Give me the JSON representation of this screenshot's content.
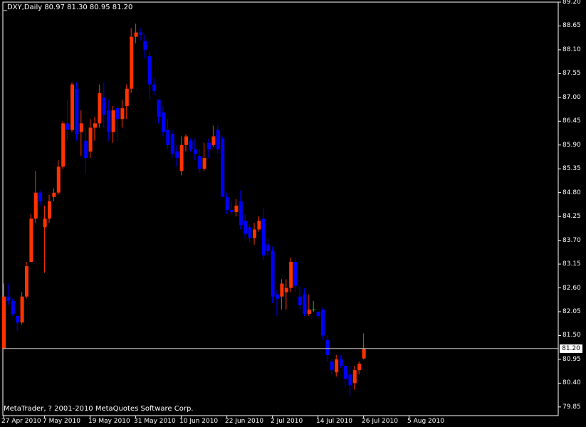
{
  "header": {
    "symbol_info": "_DXY,Daily  80.97 81.30 80.95 81.20"
  },
  "footer": {
    "copyright": "MetaTrader, ? 2001-2010 MetaQuotes Software Corp."
  },
  "colors": {
    "background": "#000000",
    "axis": "#ffffff",
    "bull": "#ff3300",
    "bear": "#0000ff",
    "doji": "#00cc00",
    "price_line": "#c0c0c0"
  },
  "chart_data": {
    "type": "candlestick",
    "symbol": "_DXY",
    "timeframe": "Daily",
    "last_price": "81.20",
    "ylim": [
      79.65,
      89.2
    ],
    "y_ticks": [
      "89.20",
      "88.65",
      "88.10",
      "87.55",
      "87.00",
      "86.45",
      "85.90",
      "85.35",
      "84.80",
      "84.25",
      "83.70",
      "83.15",
      "82.60",
      "82.05",
      "81.50",
      "80.95",
      "80.40",
      "79.85"
    ],
    "x_ticks": [
      "27 Apr 2010",
      "7 May 2010",
      "19 May 2010",
      "31 May 2010",
      "10 Jun 2010",
      "22 Jun 2010",
      "2 Jul 2010",
      "14 Jul 2010",
      "26 Jul 2010",
      "5 Aug 2010"
    ],
    "x_tick_bar_index": [
      0,
      9,
      19,
      29,
      39,
      49,
      59,
      69,
      79,
      89
    ],
    "candles": [
      {
        "o": 81.2,
        "h": 82.7,
        "l": 81.2,
        "c": 82.4
      },
      {
        "o": 82.4,
        "h": 82.7,
        "l": 82.2,
        "c": 82.3
      },
      {
        "o": 82.3,
        "h": 82.35,
        "l": 81.95,
        "c": 82.0
      },
      {
        "o": 81.95,
        "h": 81.95,
        "l": 81.6,
        "c": 81.8
      },
      {
        "o": 81.8,
        "h": 82.5,
        "l": 81.75,
        "c": 82.4
      },
      {
        "o": 82.4,
        "h": 83.2,
        "l": 82.35,
        "c": 83.1
      },
      {
        "o": 83.2,
        "h": 84.3,
        "l": 83.2,
        "c": 84.2
      },
      {
        "o": 84.2,
        "h": 85.3,
        "l": 84.1,
        "c": 84.8
      },
      {
        "o": 84.8,
        "h": 84.85,
        "l": 84.5,
        "c": 84.6
      },
      {
        "o": 84.0,
        "h": 84.5,
        "l": 82.95,
        "c": 84.2
      },
      {
        "o": 84.2,
        "h": 84.75,
        "l": 84.1,
        "c": 84.6
      },
      {
        "o": 84.7,
        "h": 84.9,
        "l": 84.6,
        "c": 84.8
      },
      {
        "o": 84.8,
        "h": 85.55,
        "l": 84.75,
        "c": 85.4
      },
      {
        "o": 85.4,
        "h": 86.45,
        "l": 85.35,
        "c": 86.4
      },
      {
        "o": 86.4,
        "h": 86.95,
        "l": 86.0,
        "c": 86.25
      },
      {
        "o": 86.25,
        "h": 87.35,
        "l": 86.2,
        "c": 87.3
      },
      {
        "o": 87.2,
        "h": 87.35,
        "l": 86.0,
        "c": 86.15
      },
      {
        "o": 86.2,
        "h": 86.7,
        "l": 85.65,
        "c": 86.4
      },
      {
        "o": 86.0,
        "h": 86.3,
        "l": 85.25,
        "c": 85.6
      },
      {
        "o": 85.75,
        "h": 86.5,
        "l": 85.6,
        "c": 86.3
      },
      {
        "o": 86.3,
        "h": 86.55,
        "l": 86.0,
        "c": 86.4
      },
      {
        "o": 86.4,
        "h": 87.3,
        "l": 86.3,
        "c": 87.1
      },
      {
        "o": 87.0,
        "h": 87.35,
        "l": 86.3,
        "c": 86.6
      },
      {
        "o": 86.7,
        "h": 86.95,
        "l": 86.0,
        "c": 86.2
      },
      {
        "o": 86.2,
        "h": 86.8,
        "l": 85.95,
        "c": 86.7
      },
      {
        "o": 86.75,
        "h": 86.8,
        "l": 86.0,
        "c": 86.5
      },
      {
        "o": 86.5,
        "h": 86.95,
        "l": 86.3,
        "c": 86.75
      },
      {
        "o": 86.8,
        "h": 87.3,
        "l": 86.5,
        "c": 87.2
      },
      {
        "o": 87.2,
        "h": 88.6,
        "l": 87.1,
        "c": 88.4
      },
      {
        "o": 88.4,
        "h": 88.7,
        "l": 88.25,
        "c": 88.5
      },
      {
        "o": 88.5,
        "h": 88.6,
        "l": 88.3,
        "c": 88.45
      },
      {
        "o": 88.3,
        "h": 88.45,
        "l": 87.9,
        "c": 88.1
      },
      {
        "o": 87.95,
        "h": 88.05,
        "l": 86.95,
        "c": 87.3
      },
      {
        "o": 87.3,
        "h": 87.45,
        "l": 87.05,
        "c": 87.15
      },
      {
        "o": 86.95,
        "h": 86.95,
        "l": 86.4,
        "c": 86.55
      },
      {
        "o": 86.65,
        "h": 86.8,
        "l": 86.1,
        "c": 86.2
      },
      {
        "o": 86.25,
        "h": 86.5,
        "l": 85.8,
        "c": 85.9
      },
      {
        "o": 86.15,
        "h": 86.25,
        "l": 85.6,
        "c": 85.7
      },
      {
        "o": 85.75,
        "h": 85.9,
        "l": 85.4,
        "c": 85.6
      },
      {
        "o": 85.3,
        "h": 86.1,
        "l": 85.2,
        "c": 85.9
      },
      {
        "o": 85.9,
        "h": 86.15,
        "l": 85.75,
        "c": 86.1
      },
      {
        "o": 86.0,
        "h": 86.05,
        "l": 85.75,
        "c": 85.8
      },
      {
        "o": 85.8,
        "h": 86.05,
        "l": 85.55,
        "c": 85.7
      },
      {
        "o": 85.65,
        "h": 85.8,
        "l": 85.25,
        "c": 85.35
      },
      {
        "o": 85.35,
        "h": 85.95,
        "l": 85.3,
        "c": 85.6
      },
      {
        "o": 85.95,
        "h": 86.05,
        "l": 85.6,
        "c": 85.8
      },
      {
        "o": 85.9,
        "h": 86.35,
        "l": 85.85,
        "c": 86.1
      },
      {
        "o": 86.25,
        "h": 86.35,
        "l": 85.7,
        "c": 85.8
      },
      {
        "o": 86.05,
        "h": 86.1,
        "l": 84.8,
        "c": 84.7
      },
      {
        "o": 84.7,
        "h": 84.8,
        "l": 84.3,
        "c": 84.4
      },
      {
        "o": 84.4,
        "h": 84.6,
        "l": 84.3,
        "c": 84.35
      },
      {
        "o": 84.35,
        "h": 84.65,
        "l": 84.25,
        "c": 84.5
      },
      {
        "o": 84.6,
        "h": 84.85,
        "l": 83.95,
        "c": 84.05
      },
      {
        "o": 84.15,
        "h": 84.3,
        "l": 83.75,
        "c": 83.85
      },
      {
        "o": 84.0,
        "h": 84.05,
        "l": 83.65,
        "c": 83.75
      },
      {
        "o": 83.75,
        "h": 84.1,
        "l": 83.6,
        "c": 83.95
      },
      {
        "o": 83.95,
        "h": 84.25,
        "l": 83.9,
        "c": 84.15
      },
      {
        "o": 84.2,
        "h": 84.45,
        "l": 83.25,
        "c": 83.35
      },
      {
        "o": 83.6,
        "h": 83.75,
        "l": 83.35,
        "c": 83.45
      },
      {
        "o": 83.45,
        "h": 83.55,
        "l": 82.25,
        "c": 82.4
      },
      {
        "o": 82.45,
        "h": 82.55,
        "l": 81.95,
        "c": 82.35
      },
      {
        "o": 82.4,
        "h": 82.8,
        "l": 82.1,
        "c": 82.7
      },
      {
        "o": 82.5,
        "h": 82.8,
        "l": 82.1,
        "c": 82.6
      },
      {
        "o": 82.6,
        "h": 83.3,
        "l": 82.5,
        "c": 83.2
      },
      {
        "o": 83.2,
        "h": 83.3,
        "l": 82.5,
        "c": 82.65
      },
      {
        "o": 82.4,
        "h": 82.65,
        "l": 82.1,
        "c": 82.2
      },
      {
        "o": 82.45,
        "h": 82.6,
        "l": 81.95,
        "c": 82.0
      },
      {
        "o": 82.0,
        "h": 82.45,
        "l": 81.95,
        "c": 82.1
      },
      {
        "o": 82.1,
        "h": 82.3,
        "l": 82.05,
        "c": 82.1
      },
      {
        "o": 82.05,
        "h": 82.05,
        "l": 81.9,
        "c": 81.95
      },
      {
        "o": 82.1,
        "h": 82.15,
        "l": 81.4,
        "c": 81.5
      },
      {
        "o": 81.4,
        "h": 81.5,
        "l": 80.9,
        "c": 81.05
      },
      {
        "o": 80.9,
        "h": 80.95,
        "l": 80.6,
        "c": 80.7
      },
      {
        "o": 80.65,
        "h": 81.05,
        "l": 80.55,
        "c": 80.95
      },
      {
        "o": 80.95,
        "h": 81.05,
        "l": 80.75,
        "c": 80.8
      },
      {
        "o": 80.8,
        "h": 80.8,
        "l": 80.3,
        "c": 80.5
      },
      {
        "o": 80.6,
        "h": 80.8,
        "l": 80.1,
        "c": 80.35
      },
      {
        "o": 80.4,
        "h": 80.8,
        "l": 80.25,
        "c": 80.7
      },
      {
        "o": 80.7,
        "h": 80.9,
        "l": 80.6,
        "c": 80.85
      },
      {
        "o": 80.97,
        "h": 81.55,
        "l": 80.95,
        "c": 81.2
      }
    ]
  }
}
